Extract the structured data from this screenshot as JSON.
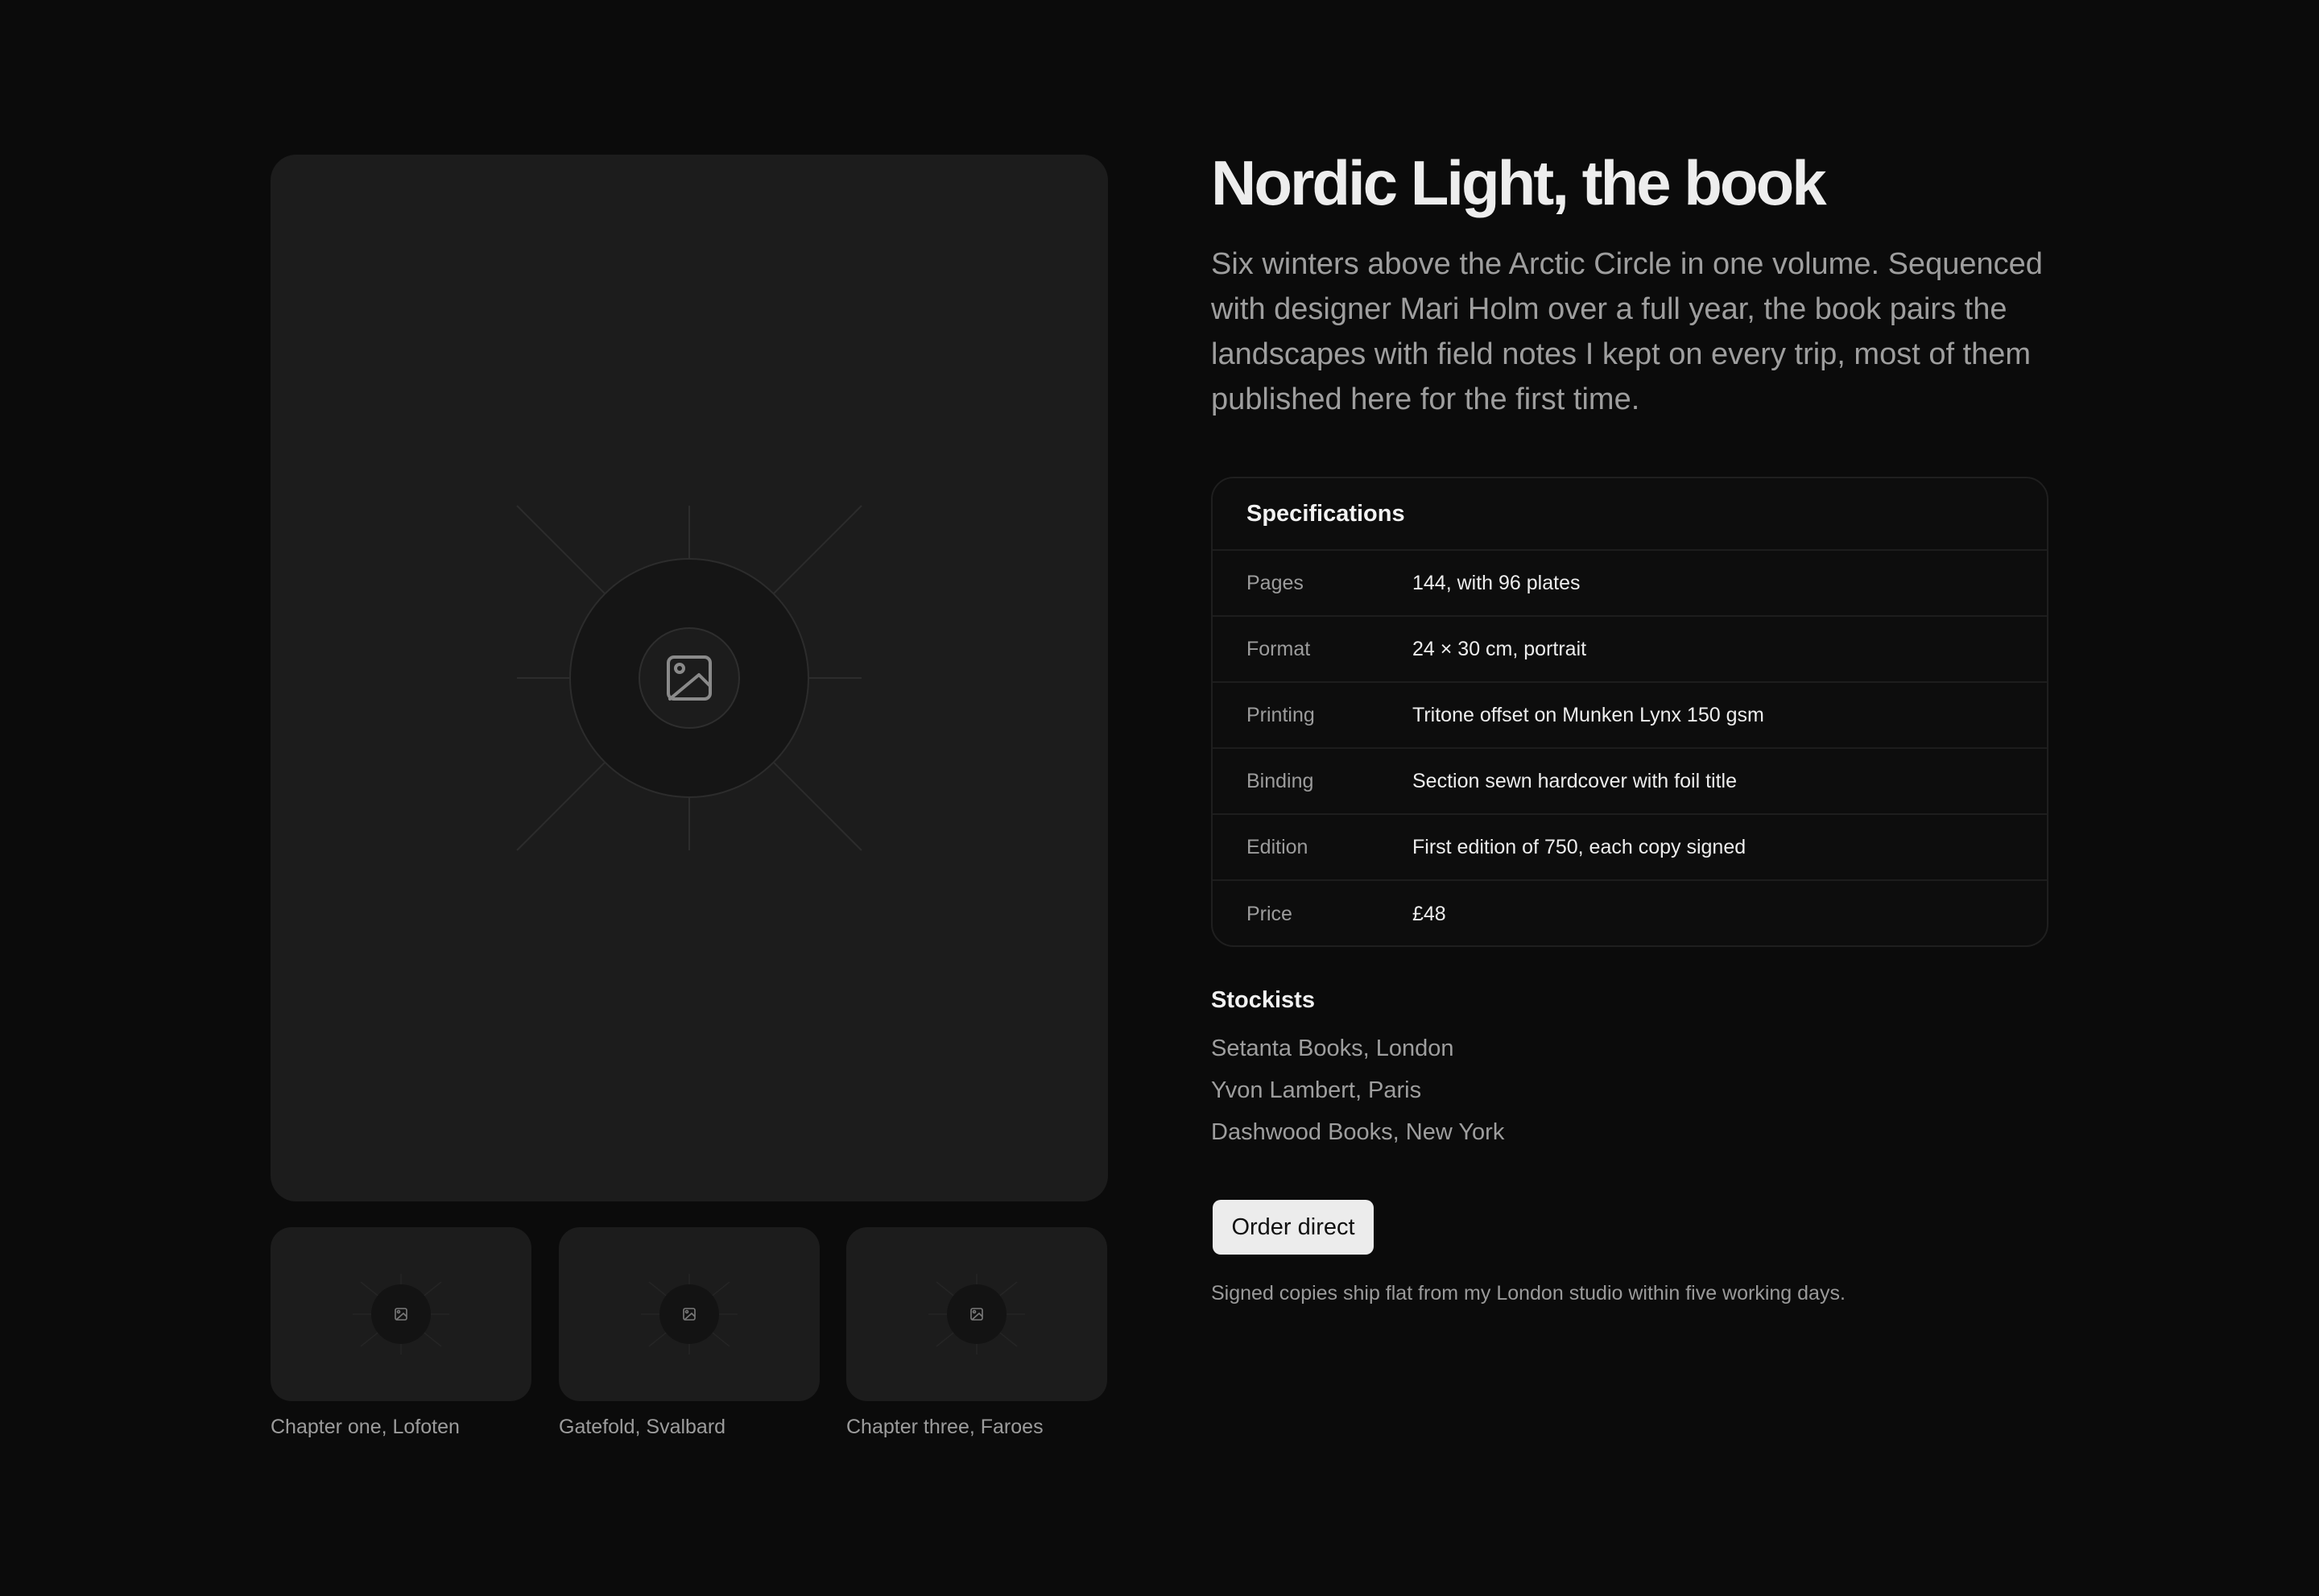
{
  "title": "Nordic Light, the book",
  "description": "Six winters above the Arctic Circle in one volume. Sequenced with designer Mari Holm over a full year, the book pairs the landscapes with field notes I kept on every trip, most of them published here for the first time.",
  "gallery": {
    "hero_icon": "image-icon",
    "thumbnails": [
      {
        "caption": "Chapter one, Lofoten",
        "icon": "image-icon"
      },
      {
        "caption": "Gatefold, Svalbard",
        "icon": "image-icon"
      },
      {
        "caption": "Chapter three, Faroes",
        "icon": "image-icon"
      }
    ]
  },
  "specs": {
    "heading": "Specifications",
    "rows": [
      {
        "label": "Pages",
        "value": "144, with 96 plates"
      },
      {
        "label": "Format",
        "value": "24 × 30 cm, portrait"
      },
      {
        "label": "Printing",
        "value": "Tritone offset on Munken Lynx 150 gsm"
      },
      {
        "label": "Binding",
        "value": "Section sewn hardcover with foil title"
      },
      {
        "label": "Edition",
        "value": "First edition of 750, each copy signed"
      },
      {
        "label": "Price",
        "value": "£48"
      }
    ]
  },
  "stockists": {
    "heading": "Stockists",
    "items": [
      "Setanta Books, London",
      "Yvon Lambert, Paris",
      "Dashwood Books, New York"
    ]
  },
  "order": {
    "button_label": "Order direct",
    "note": "Signed copies ship flat from my London studio within five working days."
  },
  "colors": {
    "background": "#0b0b0b",
    "surface": "#1c1c1c",
    "button": "#ececec"
  }
}
